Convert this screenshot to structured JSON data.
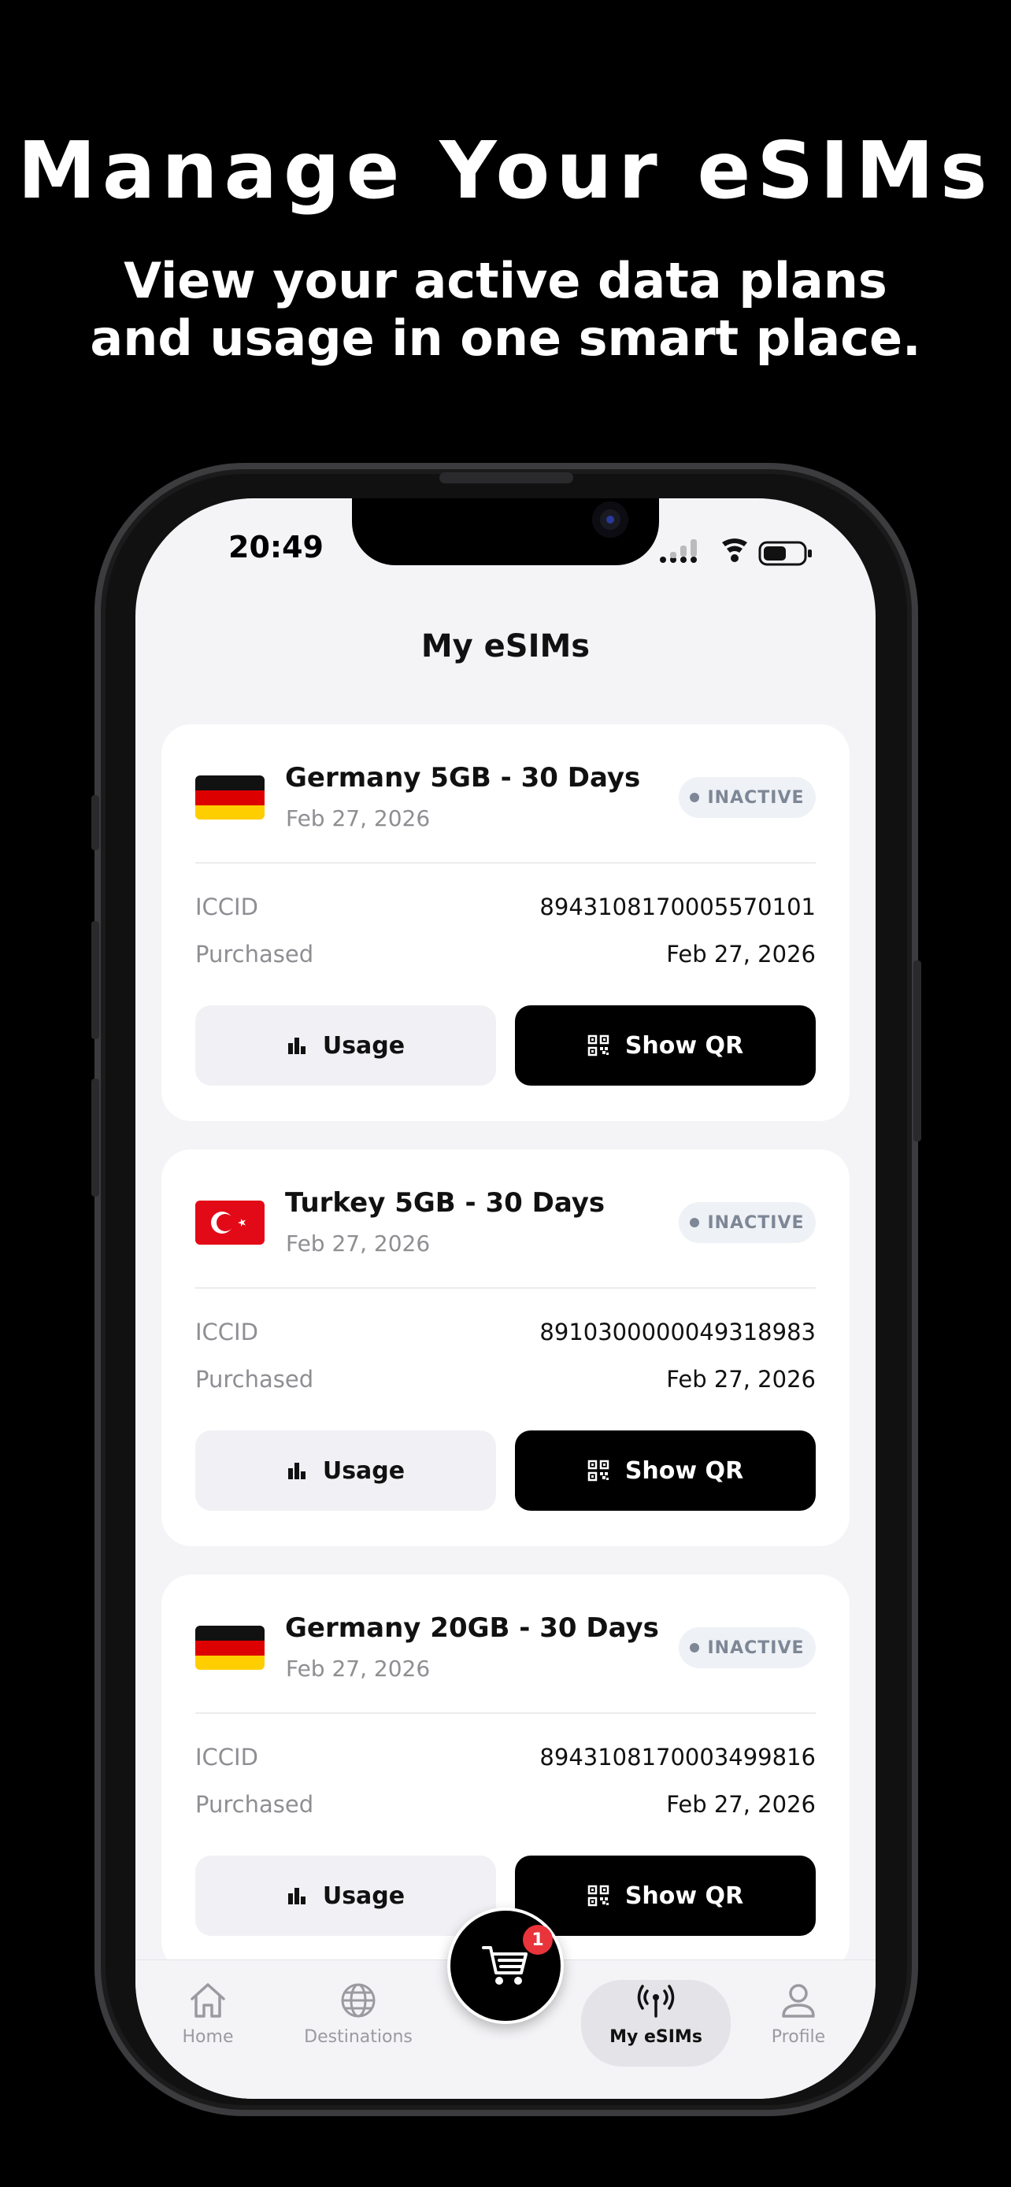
{
  "hero": {
    "title": "Manage Your eSIMs",
    "subtitle": "View your active data plans and usage in one smart place."
  },
  "status_bar": {
    "time": "20:49"
  },
  "page": {
    "title": "My eSIMs"
  },
  "labels": {
    "iccid": "ICCID",
    "purchased": "Purchased",
    "usage_button": "Usage",
    "qr_button": "Show QR"
  },
  "esims": [
    {
      "country": "Germany",
      "flag_icon": "germany-flag-icon",
      "name": "Germany 5GB - 30 Days",
      "date": "Feb 27, 2026",
      "status": "INACTIVE",
      "iccid": "8943108170005570101",
      "purchased": "Feb 27, 2026"
    },
    {
      "country": "Turkey",
      "flag_icon": "turkey-flag-icon",
      "name": "Turkey 5GB - 30 Days",
      "date": "Feb 27, 2026",
      "status": "INACTIVE",
      "iccid": "8910300000049318983",
      "purchased": "Feb 27, 2026"
    },
    {
      "country": "Germany",
      "flag_icon": "germany-flag-icon",
      "name": "Germany 20GB - 30 Days",
      "date": "Feb 27, 2026",
      "status": "INACTIVE",
      "iccid": "8943108170003499816",
      "purchased": "Feb 27, 2026"
    }
  ],
  "tabbar": {
    "home": "Home",
    "destinations": "Destinations",
    "my_esims": "My eSIMs",
    "profile": "Profile",
    "active_tab": "My eSIMs"
  },
  "cart": {
    "count": "1",
    "icon": "cart-icon"
  },
  "colors": {
    "background": "#000000",
    "screen": "#f4f4f7",
    "badge_text": "#7d8796",
    "cart_badge": "#e8343a"
  }
}
